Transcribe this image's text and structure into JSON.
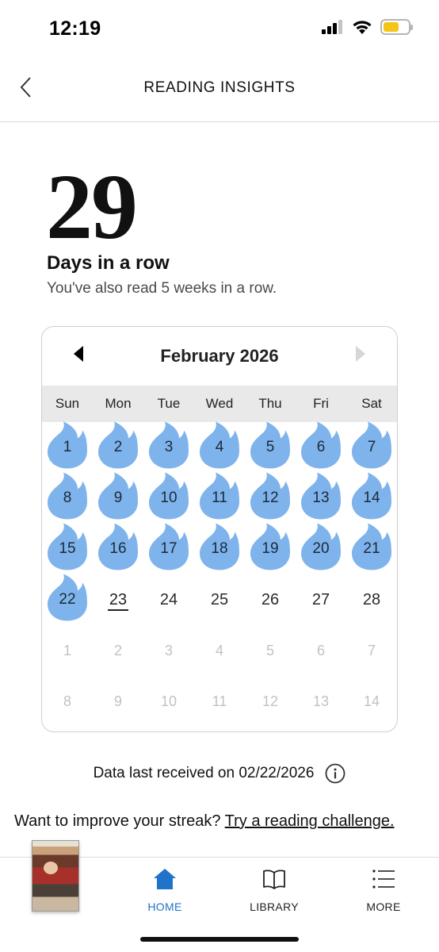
{
  "status_bar": {
    "time": "12:19"
  },
  "header": {
    "title": "READING INSIGHTS"
  },
  "streak": {
    "count": "29",
    "label": "Days in a row",
    "subtext": "You've also read 5 weeks in a row."
  },
  "calendar": {
    "month": "February 2026",
    "weekdays": [
      "Sun",
      "Mon",
      "Tue",
      "Wed",
      "Thu",
      "Fri",
      "Sat"
    ],
    "read_color": "#7fb3ec",
    "days": [
      {
        "d": "1",
        "state": "read"
      },
      {
        "d": "2",
        "state": "read"
      },
      {
        "d": "3",
        "state": "read"
      },
      {
        "d": "4",
        "state": "read"
      },
      {
        "d": "5",
        "state": "read"
      },
      {
        "d": "6",
        "state": "read"
      },
      {
        "d": "7",
        "state": "read"
      },
      {
        "d": "8",
        "state": "read"
      },
      {
        "d": "9",
        "state": "read"
      },
      {
        "d": "10",
        "state": "read"
      },
      {
        "d": "11",
        "state": "read"
      },
      {
        "d": "12",
        "state": "read"
      },
      {
        "d": "13",
        "state": "read"
      },
      {
        "d": "14",
        "state": "read"
      },
      {
        "d": "15",
        "state": "read"
      },
      {
        "d": "16",
        "state": "read"
      },
      {
        "d": "17",
        "state": "read"
      },
      {
        "d": "18",
        "state": "read"
      },
      {
        "d": "19",
        "state": "read"
      },
      {
        "d": "20",
        "state": "read"
      },
      {
        "d": "21",
        "state": "read"
      },
      {
        "d": "22",
        "state": "read"
      },
      {
        "d": "23",
        "state": "today"
      },
      {
        "d": "24",
        "state": "future"
      },
      {
        "d": "25",
        "state": "future"
      },
      {
        "d": "26",
        "state": "future"
      },
      {
        "d": "27",
        "state": "future"
      },
      {
        "d": "28",
        "state": "future"
      },
      {
        "d": "1",
        "state": "other"
      },
      {
        "d": "2",
        "state": "other"
      },
      {
        "d": "3",
        "state": "other"
      },
      {
        "d": "4",
        "state": "other"
      },
      {
        "d": "5",
        "state": "other"
      },
      {
        "d": "6",
        "state": "other"
      },
      {
        "d": "7",
        "state": "other"
      },
      {
        "d": "8",
        "state": "other"
      },
      {
        "d": "9",
        "state": "other"
      },
      {
        "d": "10",
        "state": "other"
      },
      {
        "d": "11",
        "state": "other"
      },
      {
        "d": "12",
        "state": "other"
      },
      {
        "d": "13",
        "state": "other"
      },
      {
        "d": "14",
        "state": "other"
      }
    ]
  },
  "data_received": {
    "text": "Data last received on 02/22/2026"
  },
  "improve": {
    "prompt": "Want to improve your streak?",
    "link": "Try a reading challenge."
  },
  "nav": {
    "active_color": "#1f73c9",
    "home": "HOME",
    "library": "LIBRARY",
    "more": "MORE"
  }
}
